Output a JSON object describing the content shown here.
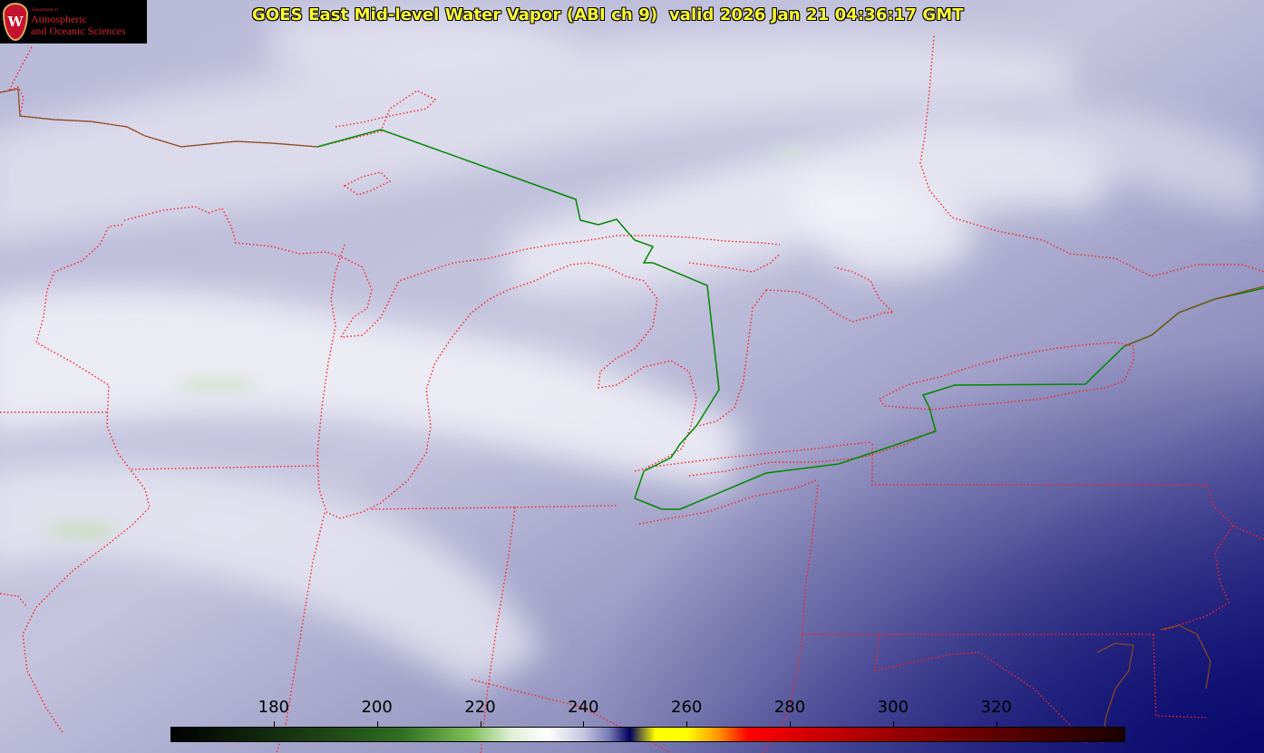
{
  "title": "GOES East Mid-level Water Vapor (ABI ch 9)  valid 2026 Jan 21 04:36:17 GMT",
  "logo": {
    "crest_letter": "W",
    "dept": "Department of",
    "line1": "Atmospheric",
    "line2": "and Oceanic Sciences"
  },
  "colorbar": {
    "min": 160,
    "max": 345,
    "ticks": [
      "180",
      "200",
      "220",
      "240",
      "260",
      "280",
      "300",
      "320"
    ],
    "stops": [
      {
        "value": 160,
        "color": "#000000"
      },
      {
        "value": 190,
        "color": "#1e4416"
      },
      {
        "value": 205,
        "color": "#2f7023"
      },
      {
        "value": 218,
        "color": "#7fbf58"
      },
      {
        "value": 226,
        "color": "#dfeed6"
      },
      {
        "value": 233,
        "color": "#ffffff"
      },
      {
        "value": 240,
        "color": "#c6c6e0"
      },
      {
        "value": 245,
        "color": "#7a7ab6"
      },
      {
        "value": 249,
        "color": "#00005e"
      },
      {
        "value": 254,
        "color": "#ffff00"
      },
      {
        "value": 260,
        "color": "#ffff00"
      },
      {
        "value": 266,
        "color": "#ff9800"
      },
      {
        "value": 272,
        "color": "#ff0000"
      },
      {
        "value": 300,
        "color": "#9a0000"
      },
      {
        "value": 330,
        "color": "#400000"
      },
      {
        "value": 345,
        "color": "#1a0000"
      }
    ]
  },
  "colors": {
    "background": "#8f8fbd",
    "border_lines": "#ff2020",
    "international_border": "#008800",
    "title_text": "#ffff33"
  }
}
